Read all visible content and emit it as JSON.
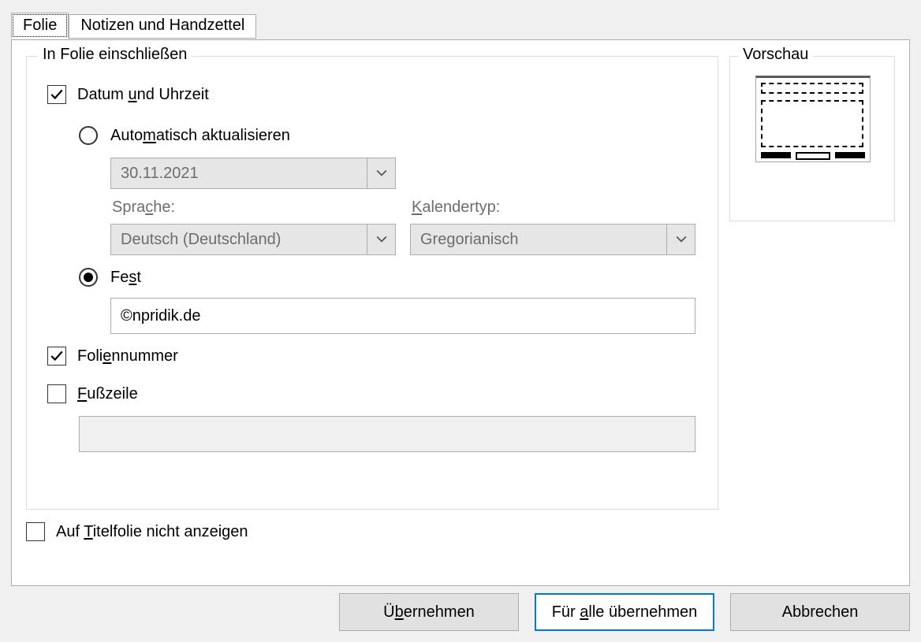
{
  "tabs": {
    "slide": "Folie",
    "notes": "Notizen und Handzettel"
  },
  "group": {
    "include_legend": "In Folie einschließen",
    "preview_legend": "Vorschau"
  },
  "datetime": {
    "label_pre": "Datum ",
    "label_u": "u",
    "label_post": "nd Uhrzeit",
    "auto_pre": "Auto",
    "auto_u": "m",
    "auto_post": "atisch aktualisieren",
    "date_value": "30.11.2021",
    "lang_label_pre": "Spra",
    "lang_label_u": "c",
    "lang_label_post": "he:",
    "lang_value": "Deutsch (Deutschland)",
    "cal_label_u": "K",
    "cal_label_post": "alendertyp:",
    "cal_value": "Gregorianisch",
    "fixed_pre": "Fe",
    "fixed_u": "s",
    "fixed_post": "t",
    "fixed_value": "©npridik.de"
  },
  "slidenum": {
    "pre": "Foli",
    "u": "e",
    "post": "nnummer"
  },
  "footer": {
    "u": "F",
    "post": "ußzeile",
    "value": ""
  },
  "titlehide": {
    "pre": "Auf ",
    "u": "T",
    "post": "itelfolie nicht anzeigen"
  },
  "buttons": {
    "apply_pre": "Ü",
    "apply_u": "b",
    "apply_post": "ernehmen",
    "applyall_pre": "Für ",
    "applyall_u": "a",
    "applyall_post": "lle übernehmen",
    "cancel": "Abbrechen"
  }
}
